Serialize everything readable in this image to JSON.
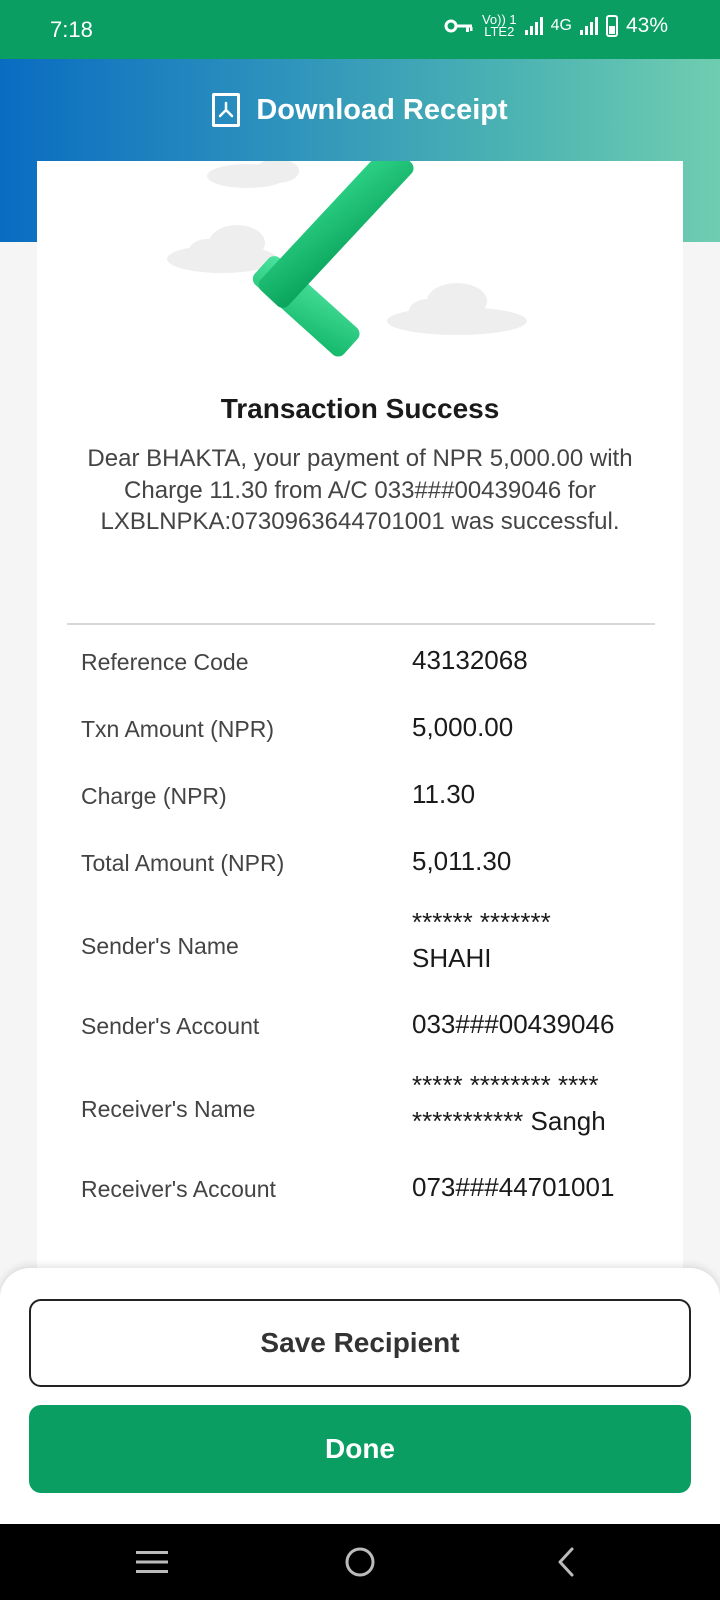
{
  "status_bar": {
    "time": "7:18",
    "volte_top": "Vo)) 1",
    "volte_bottom": "LTE2",
    "network": "4G",
    "battery": "43%",
    "battery_level": 0.43
  },
  "header": {
    "title": "Download Receipt",
    "icon": "pdf-file-icon"
  },
  "receipt": {
    "status_icon": "checkmark-icon",
    "title": "Transaction Success",
    "message": "Dear BHAKTA, your payment of NPR 5,000.00 with Charge 11.30 from A/C 033###00439046 for LXBLNPKA:0730963644701001 was successful.",
    "rows": [
      {
        "label": "Reference Code",
        "value": "43132068"
      },
      {
        "label": "Txn Amount (NPR)",
        "value": "5,000.00"
      },
      {
        "label": "Charge (NPR)",
        "value": "11.30"
      },
      {
        "label": "Total Amount (NPR)",
        "value": "5,011.30"
      },
      {
        "label": "Sender's Name",
        "value_line1": "****** *******",
        "value_line2": "SHAHI"
      },
      {
        "label": "Sender's Account",
        "value": "033###00439046"
      },
      {
        "label": "Receiver's Name",
        "value_line1": "***** ******** ****",
        "value_line2": "*********** Sangh"
      },
      {
        "label": "Receiver's Account",
        "value": "073###44701001"
      }
    ]
  },
  "actions": {
    "save_recipient": "Save Recipient",
    "done": "Done"
  },
  "colors": {
    "primary_green": "#0a9e63",
    "header_gradient_start": "#0a6cc1",
    "header_gradient_end": "#6fcdb0"
  },
  "navbar": {
    "recent_icon": "recent-apps-icon",
    "home_icon": "home-icon",
    "back_icon": "back-icon"
  }
}
